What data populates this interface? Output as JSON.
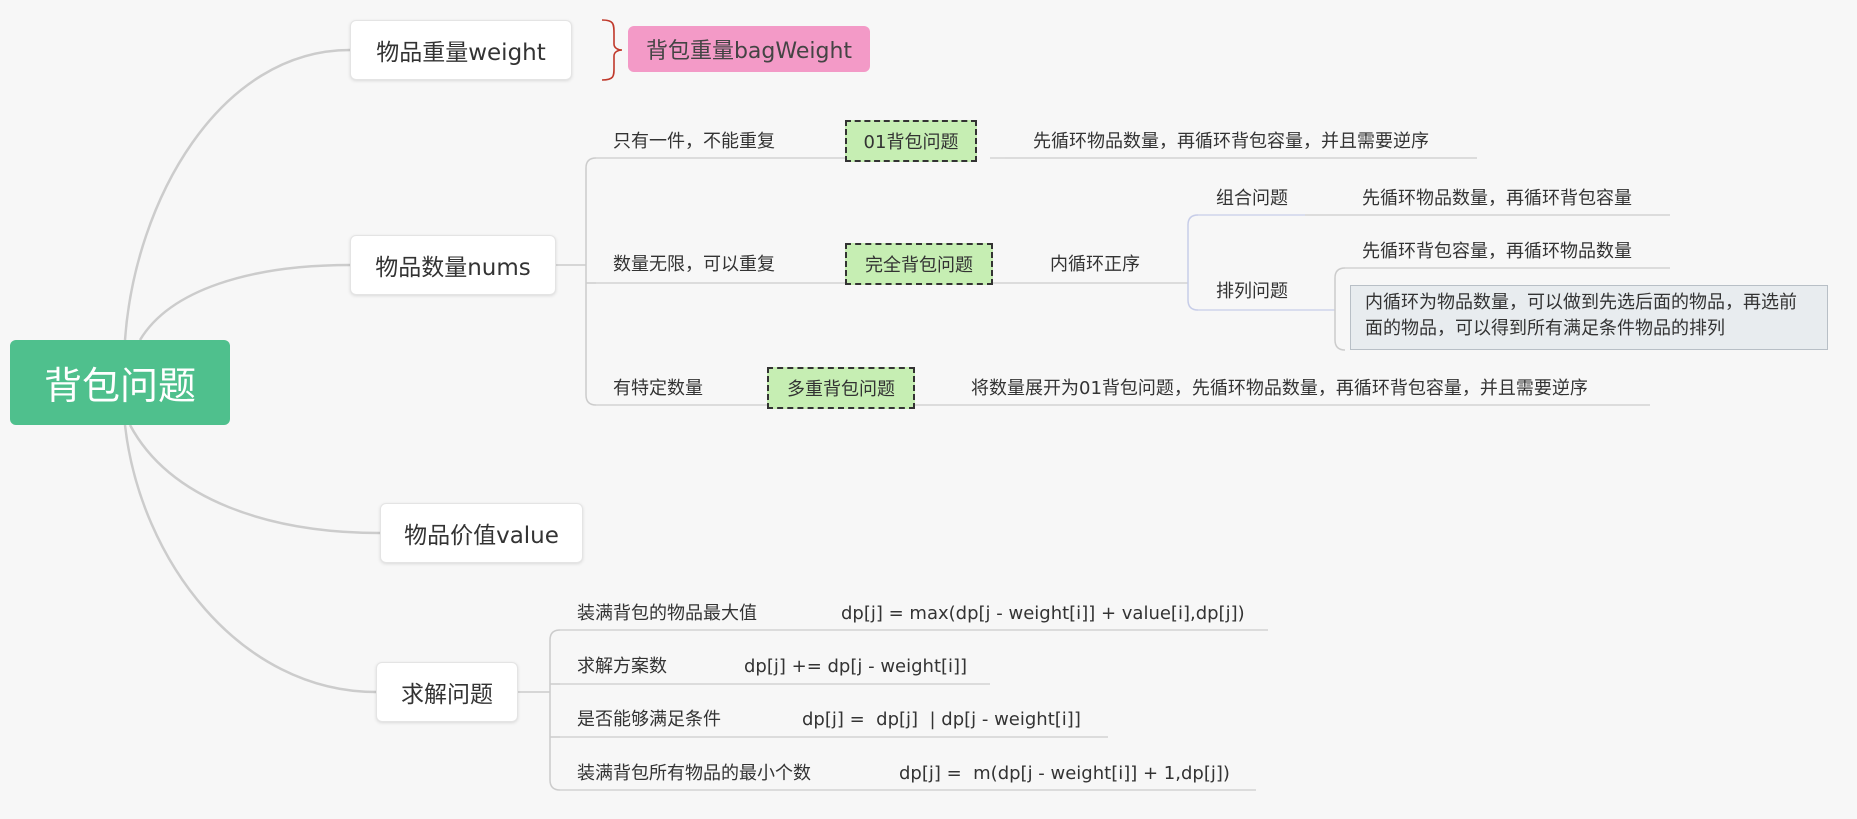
{
  "root": {
    "label": "背包问题"
  },
  "branches": {
    "weight": "物品重量weight",
    "bag_weight": "背包重量bagWeight",
    "nums": "物品数量nums",
    "value": "物品价值value",
    "solve": "求解问题"
  },
  "nums_children": [
    {
      "condition": "只有一件，不能重复",
      "problem": "01背包问题",
      "note": "先循环物品数量，再循环背包容量，并且需要逆序"
    },
    {
      "condition": "数量无限，可以重复",
      "problem": "完全背包问题",
      "note": "内循环正序",
      "sub": [
        {
          "label": "组合问题",
          "notes": [
            "先循环物品数量，再循环背包容量"
          ]
        },
        {
          "label": "排列问题",
          "notes": [
            "先循环背包容量，再循环物品数量",
            "内循环为物品数量，可以做到先选后面的物品，再选前面的物品，可以得到所有满足条件物品的排列"
          ]
        }
      ]
    },
    {
      "condition": "有特定数量",
      "problem": "多重背包问题",
      "note": "将数量展开为01背包问题，先循环物品数量，再循环背包容量，并且需要逆序"
    }
  ],
  "solve_children": [
    {
      "label": "装满背包的物品最大值",
      "formula": "dp[j] = max(dp[j - weight[i]] + value[i],dp[j])"
    },
    {
      "label": "求解方案数",
      "formula": "dp[j] += dp[j - weight[i]]"
    },
    {
      "label": "是否能够满足条件",
      "formula": "dp[j] =  dp[j]  | dp[j - weight[i]]"
    },
    {
      "label": "装满背包所有物品的最小个数",
      "formula": "dp[j] =  m(dp[j - weight[i]] + 1,dp[j])"
    }
  ],
  "colors": {
    "root": "#4fc08d",
    "summary_pink": "#f39ac7",
    "summary_brace": "#c0392b",
    "problem_green": "#c6eeb3",
    "connector": "#cccccc",
    "sub_connector": "#c7cde8"
  }
}
